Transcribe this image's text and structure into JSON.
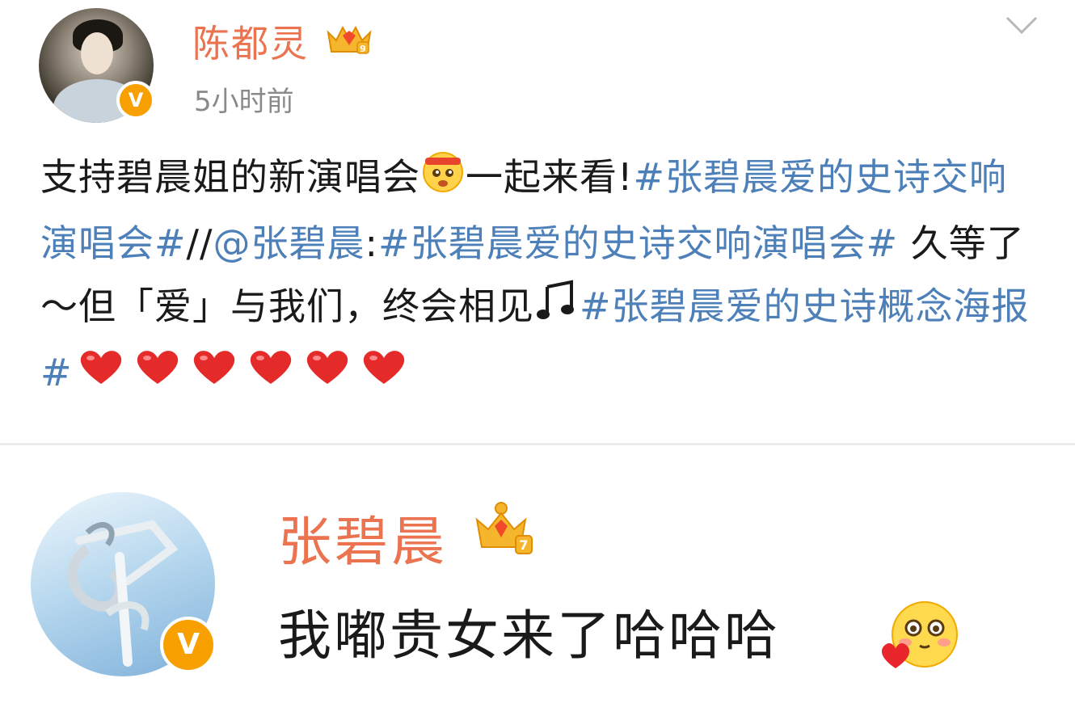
{
  "post": {
    "username": "陈都灵",
    "timestamp": "5小时前",
    "text_parts": {
      "p1": "支持碧晨姐的新演唱会",
      "p2": "一起来看!",
      "topic1": "#张碧晨爱的史诗交响演唱会#",
      "p3": "//",
      "mention": "@张碧晨",
      "p4": ":",
      "topic2": "#张碧晨爱的史诗交响演唱会#",
      "p5": " 久等了～但「爱」与我们，终会相见",
      "topic3": "#张碧晨爱的史诗概念海报#"
    },
    "heart_count": 6,
    "icons": {
      "verified": "verified-v-badge-icon",
      "crown": "crown-icon",
      "more": "chevron-down-icon",
      "emoji1": "headband-smile-emoji",
      "music": "music-note-icon",
      "heart": "red-heart-icon"
    }
  },
  "reply": {
    "username": "张碧晨",
    "text": "我嘟贵女来了哈哈哈",
    "icons": {
      "verified": "verified-v-badge-icon",
      "crown": "crown-icon",
      "emoji": "blushing-heart-emoji"
    }
  },
  "colors": {
    "username": "#eb7350",
    "link": "#4d7fb8",
    "timestamp": "#8a8a8a",
    "badge": "#f7a000",
    "divider": "#ececec"
  }
}
